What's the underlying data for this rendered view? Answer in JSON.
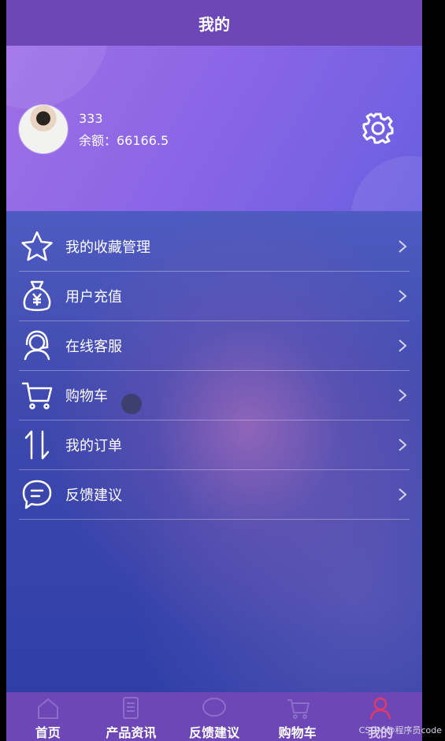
{
  "header": {
    "title": "我的"
  },
  "profile": {
    "username": "333",
    "balance_text": "余额：66166.5"
  },
  "menu": {
    "items": [
      {
        "label": "我的收藏管理",
        "icon": "star-icon"
      },
      {
        "label": "用户充值",
        "icon": "money-bag-icon"
      },
      {
        "label": "在线客服",
        "icon": "customer-service-icon"
      },
      {
        "label": "购物车",
        "icon": "cart-icon"
      },
      {
        "label": "我的订单",
        "icon": "sort-arrows-icon"
      },
      {
        "label": "反馈建议",
        "icon": "chat-bubble-icon"
      }
    ]
  },
  "tabs": [
    {
      "label": "首页",
      "icon": "home-icon",
      "active": false
    },
    {
      "label": "产品资讯",
      "icon": "document-icon",
      "active": false
    },
    {
      "label": "反馈建议",
      "icon": "chat-icon",
      "active": false
    },
    {
      "label": "购物车",
      "icon": "cart-icon",
      "active": false
    },
    {
      "label": "我的",
      "icon": "user-icon",
      "active": true
    }
  ],
  "watermark": "CSDN @程序员code",
  "colors": {
    "title_bar": "#6d47b6",
    "tab_bar": "#6d47b6",
    "active_tab_icon": "#e0396a"
  }
}
